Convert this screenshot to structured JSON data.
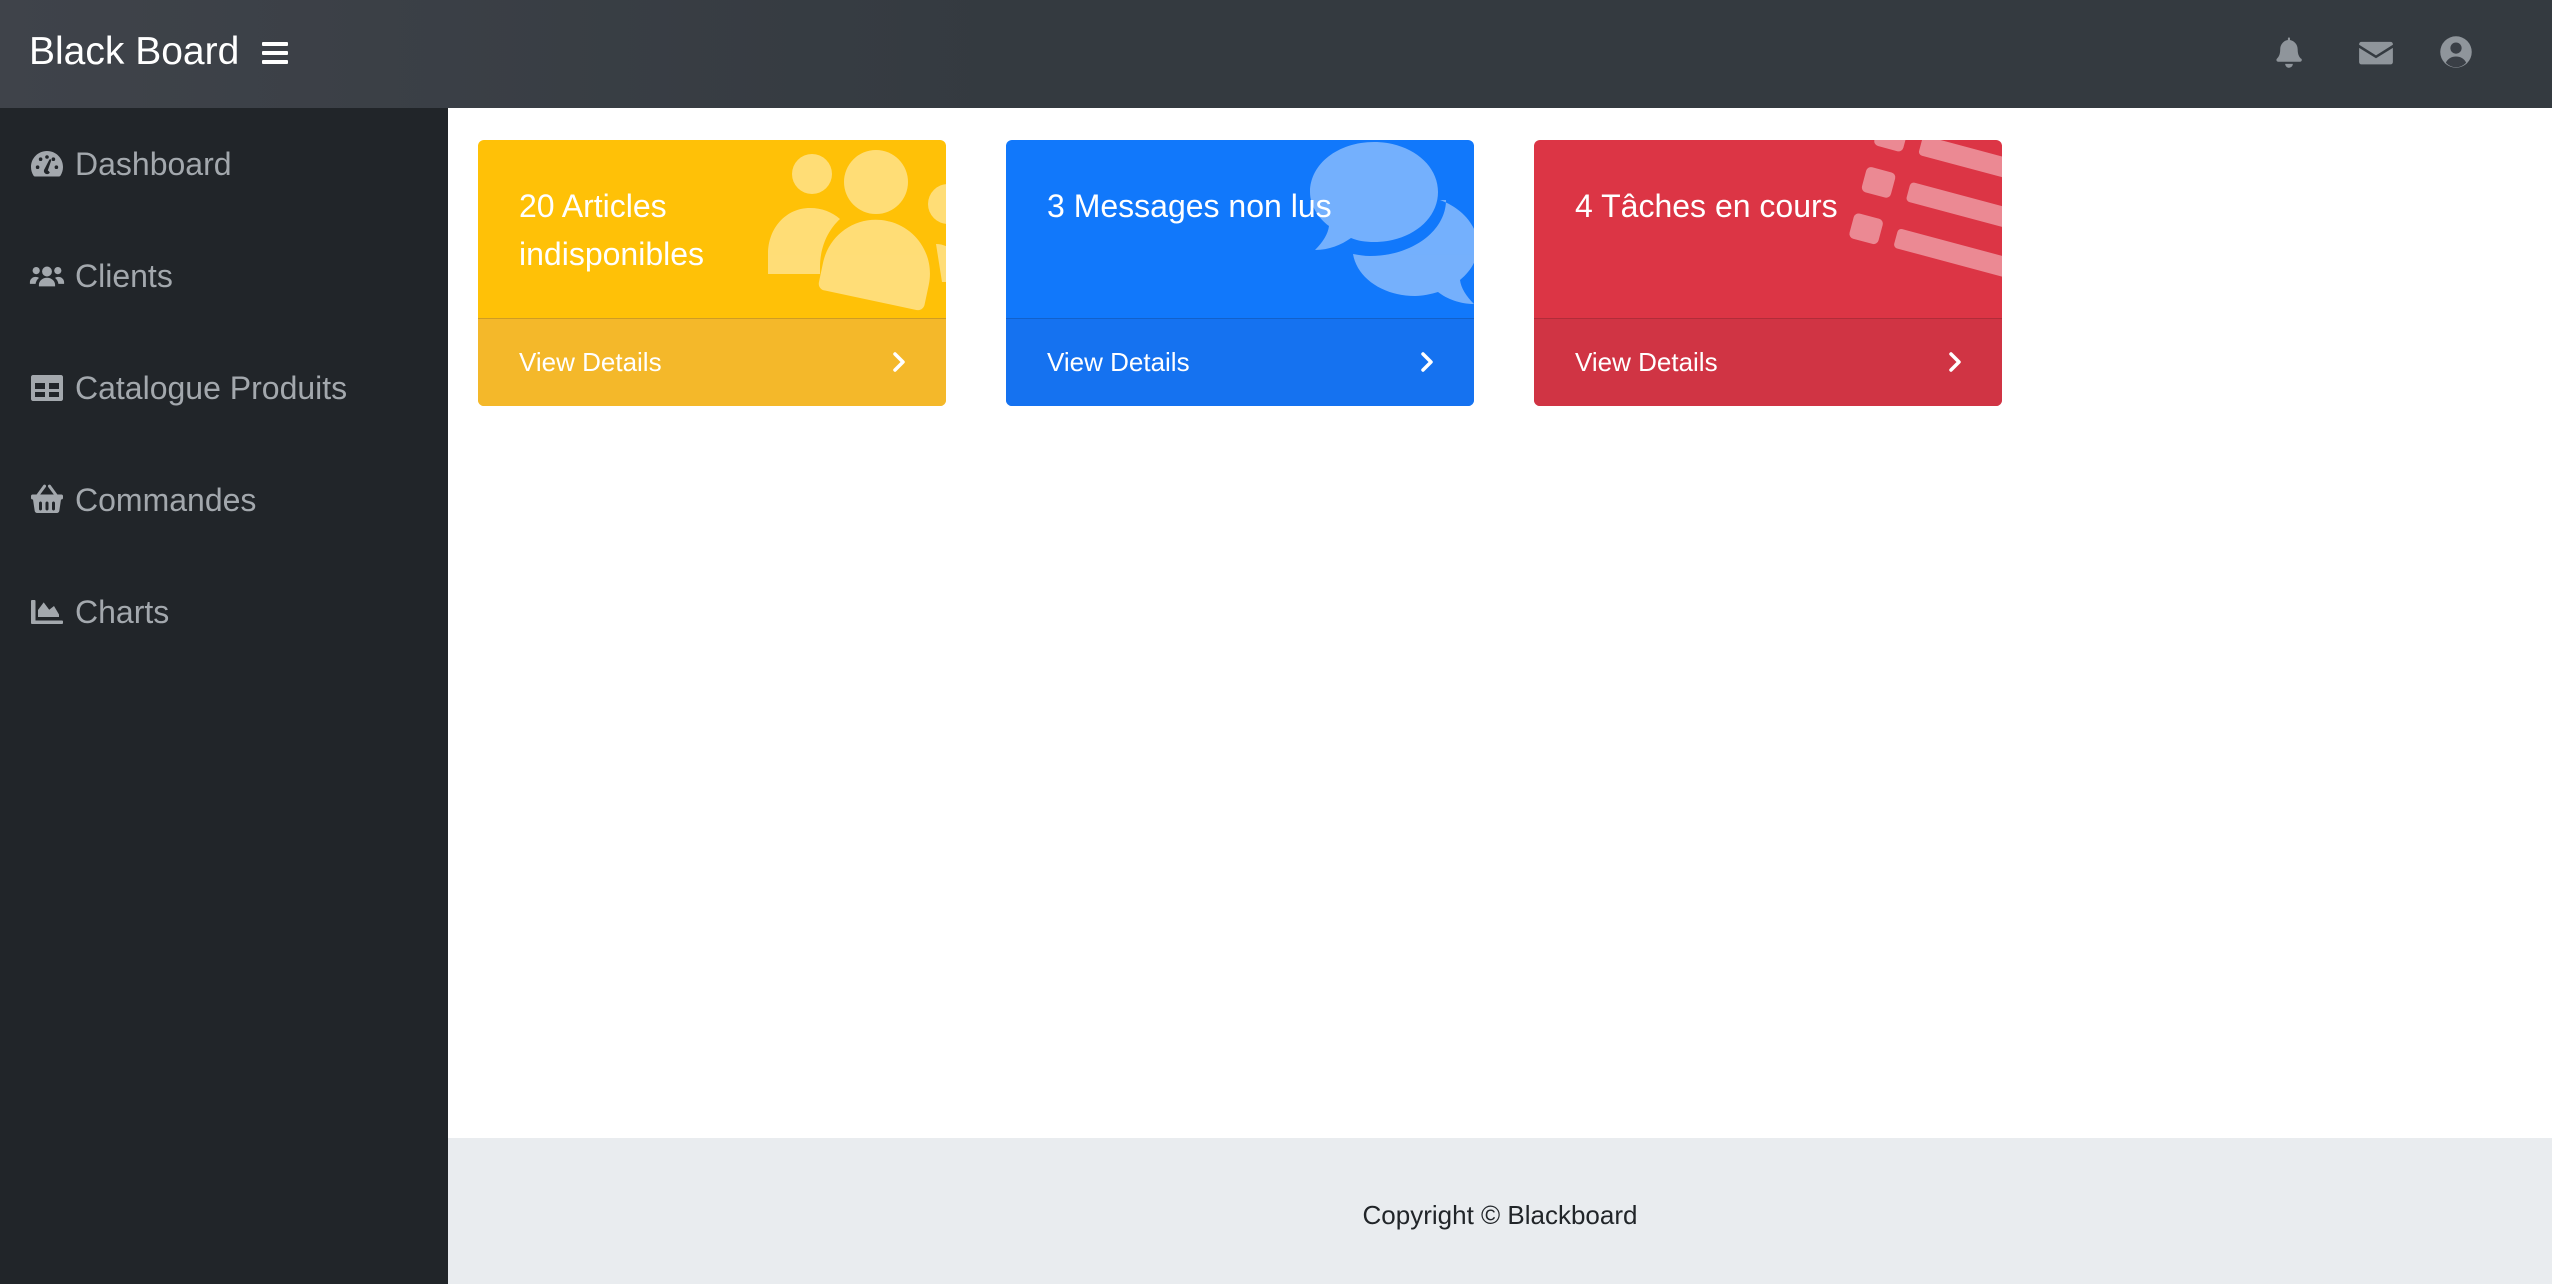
{
  "header": {
    "brand": "Black Board",
    "icons": [
      "bell-icon",
      "envelope-icon",
      "user-circle-icon"
    ]
  },
  "sidebar": {
    "items": [
      {
        "label": "Dashboard",
        "icon": "tachometer-icon"
      },
      {
        "label": "Clients",
        "icon": "users-icon"
      },
      {
        "label": "Catalogue Produits",
        "icon": "table-icon"
      },
      {
        "label": "Commandes",
        "icon": "shopping-basket-icon"
      },
      {
        "label": "Charts",
        "icon": "area-chart-icon"
      }
    ]
  },
  "cards": [
    {
      "title": "20 Articles indisponibles",
      "link": "View Details",
      "color": "#ffc107",
      "footer_color": "#f4b82a",
      "icon": "users-icon"
    },
    {
      "title": "3 Messages non lus",
      "link": "View Details",
      "color": "#1178fb",
      "footer_color": "#1572f0",
      "icon": "comments-icon"
    },
    {
      "title": "4 Tâches en cours",
      "link": "View Details",
      "color": "#dc3545",
      "footer_color": "#d03444",
      "icon": "tasks-icon"
    }
  ],
  "footer": {
    "copyright": "Copyright © Blackboard"
  }
}
